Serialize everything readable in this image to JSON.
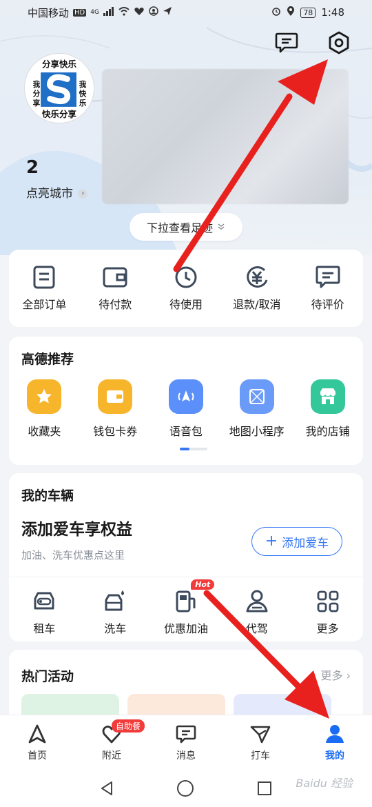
{
  "status_bar": {
    "carrier": "中国移动",
    "network_badge": "HD",
    "network_type": "4G",
    "battery": "78",
    "time": "1:48"
  },
  "header": {
    "avatar_text": "我分享快乐",
    "lit_cities_count": "2",
    "lit_cities_label": "点亮城市",
    "pull_label": "下拉查看足迹",
    "message_icon": "message-icon",
    "settings_icon": "settings-hexagon-icon"
  },
  "orders": [
    {
      "label": "全部订单",
      "icon": "orders-list-icon"
    },
    {
      "label": "待付款",
      "icon": "wallet-icon"
    },
    {
      "label": "待使用",
      "icon": "clock-icon"
    },
    {
      "label": "退款/取消",
      "icon": "refund-yen-icon"
    },
    {
      "label": "待评价",
      "icon": "review-icon"
    }
  ],
  "recommend": {
    "title": "高德推荐",
    "items": [
      {
        "label": "收藏夹",
        "icon": "star-icon",
        "color": "#f7b52c"
      },
      {
        "label": "钱包卡券",
        "icon": "wallet-icon",
        "color": "#f7b52c"
      },
      {
        "label": "语音包",
        "icon": "voice-icon",
        "color": "#5b8ff9"
      },
      {
        "label": "地图小程序",
        "icon": "map-app-icon",
        "color": "#6b9bf8"
      },
      {
        "label": "我的店铺",
        "icon": "shop-icon",
        "color": "#34c79a"
      }
    ]
  },
  "vehicle": {
    "title": "我的车辆",
    "promo": "添加爱车享权益",
    "subtitle": "加油、洗车优惠点这里",
    "add_button": "添加爱车",
    "items": [
      {
        "label": "租车",
        "icon": "rent-car-icon"
      },
      {
        "label": "洗车",
        "icon": "car-wash-icon"
      },
      {
        "label": "优惠加油",
        "icon": "fuel-icon",
        "badge": "Hot"
      },
      {
        "label": "代驾",
        "icon": "driver-icon"
      },
      {
        "label": "更多",
        "icon": "grid-more-icon"
      }
    ]
  },
  "activities": {
    "title": "热门活动",
    "more": "更多"
  },
  "tabbar": [
    {
      "label": "首页",
      "icon": "navigate-arrow-icon",
      "active": false
    },
    {
      "label": "附近",
      "icon": "nearby-heart-icon",
      "active": false,
      "badge": "自助餐"
    },
    {
      "label": "消息",
      "icon": "message-icon",
      "active": false
    },
    {
      "label": "打车",
      "icon": "taxi-icon",
      "active": false
    },
    {
      "label": "我的",
      "icon": "profile-icon",
      "active": true
    }
  ],
  "watermark": "Baidu 经验",
  "colors": {
    "accent": "#3677f6",
    "active_tab": "#1a6cf4",
    "badge_red": "#f23b3b",
    "annotation_arrow": "#e8211e"
  }
}
